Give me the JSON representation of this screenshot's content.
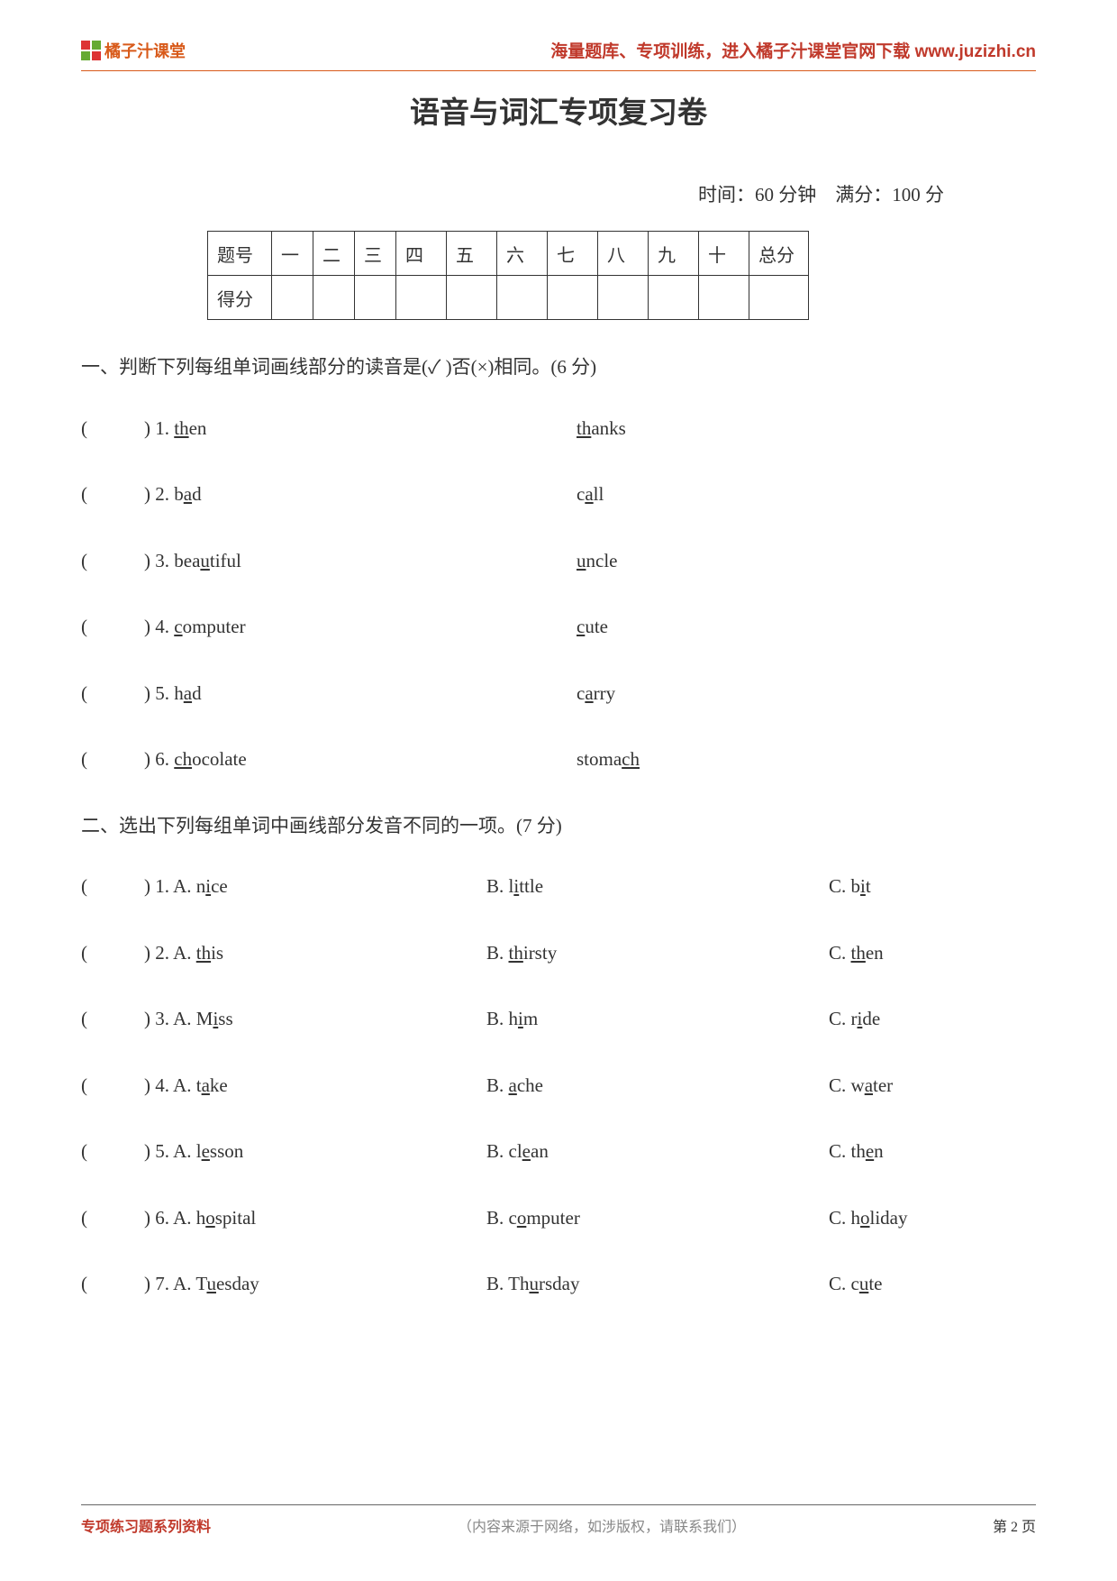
{
  "header": {
    "logo_text": "橘子汁课堂",
    "right_text": "海量题库、专项训练，进入橘子汁课堂官网下载 www.juzizhi.cn"
  },
  "title": "语音与词汇专项复习卷",
  "timefull": "时间：60 分钟　满分：100 分",
  "table": {
    "cols": [
      "题号",
      "一",
      "二",
      "三",
      "四",
      "五",
      "六",
      "七",
      "八",
      "九",
      "十",
      "总分"
    ],
    "row2": "得分"
  },
  "section1": {
    "title": "一、判断下列每组单词画线部分的读音是(✓ )否(×)相同。(6 分)",
    "items": [
      {
        "n": "1",
        "w1a": "th",
        "w1b": "en",
        "w2a": "th",
        "w2b": "anks"
      },
      {
        "n": "2",
        "w1a": "b",
        "w1u": "a",
        "w1b": "d",
        "w2a": "c",
        "w2u": "a",
        "w2b": "ll"
      },
      {
        "n": "3",
        "w1a": "bea",
        "w1u": "u",
        "w1b": "tiful",
        "w2a": "",
        "w2u": "u",
        "w2b": "ncle"
      },
      {
        "n": "4",
        "w1a": "",
        "w1u": "c",
        "w1b": "omputer",
        "w2a": "",
        "w2u": "c",
        "w2b": "ute"
      },
      {
        "n": "5",
        "w1a": "h",
        "w1u": "a",
        "w1b": "d",
        "w2a": "c",
        "w2u": "a",
        "w2b": "rry"
      },
      {
        "n": "6",
        "w1a": "",
        "w1u": "ch",
        "w1b": "ocolate",
        "w2a": "stoma",
        "w2u": "ch",
        "w2b": ""
      }
    ]
  },
  "section2": {
    "title": "二、选出下列每组单词中画线部分发音不同的一项。(7 分)",
    "items": [
      {
        "n": "1",
        "aa": "n",
        "au": "i",
        "ab": "ce",
        "ba": "l",
        "bu": "i",
        "bb": "ttle",
        "ca": "b",
        "cu": "i",
        "cb": "t"
      },
      {
        "n": "2",
        "aa": "",
        "au": "th",
        "ab": "is",
        "ba": "",
        "bu": "th",
        "bb": "irsty",
        "ca": "",
        "cu": "th",
        "cb": "en"
      },
      {
        "n": "3",
        "aa": "M",
        "au": "i",
        "ab": "ss",
        "ba": "h",
        "bu": "i",
        "bb": "m",
        "ca": "r",
        "cu": "i",
        "cb": "de"
      },
      {
        "n": "4",
        "aa": "t",
        "au": "a",
        "ab": "ke",
        "ba": "",
        "bu": "a",
        "bb": "che",
        "ca": "w",
        "cu": "a",
        "cb": "ter"
      },
      {
        "n": "5",
        "aa": "l",
        "au": "e",
        "ab": "sson",
        "ba": "cl",
        "bu": "e",
        "bb": "an",
        "ca": "th",
        "cu": "e",
        "cb": "n"
      },
      {
        "n": "6",
        "aa": "h",
        "au": "o",
        "ab": "spital",
        "ba": "c",
        "bu": "o",
        "bb": "mputer",
        "ca": "h",
        "cu": "o",
        "cb": "liday"
      },
      {
        "n": "7",
        "aa": "T",
        "au": "u",
        "ab": "esday",
        "ba": "Th",
        "bu": "u",
        "bb": "rsday",
        "ca": "c",
        "cu": "u",
        "cb": "te"
      }
    ]
  },
  "labels": {
    "bracket_open": "(",
    "bracket_gap": "　　",
    "bracket_close": ") ",
    "A": "A. ",
    "B": "B. ",
    "C": "C. "
  },
  "footer": {
    "left": "专项练习题系列资料",
    "mid": "（内容来源于网络，如涉版权，请联系我们）",
    "right": "第 2 页"
  }
}
